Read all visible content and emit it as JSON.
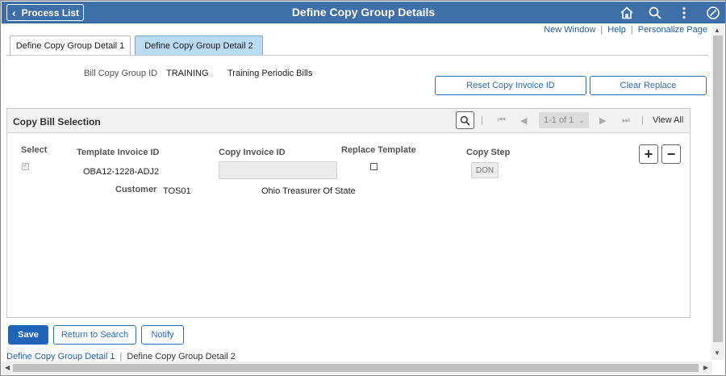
{
  "header": {
    "back_label": "Process List",
    "title": "Define Copy Group Details",
    "icons": [
      "home-icon",
      "search-icon",
      "more-vertical-icon",
      "nav-circle-icon"
    ]
  },
  "top_links": {
    "new_window": "New Window",
    "help": "Help",
    "personalize": "Personalize Page"
  },
  "tabs": [
    {
      "label": "Define Copy Group Detail 1",
      "active": false
    },
    {
      "label": "Define Copy Group Detail 2",
      "active": true
    }
  ],
  "bill_copy_group": {
    "label": "Bill Copy Group ID",
    "id": "TRAINING",
    "description": "Training Periodic Bills"
  },
  "actions": {
    "reset": "Reset Copy Invoice ID",
    "clear": "Clear Replace"
  },
  "grid": {
    "title": "Copy Bill Selection",
    "pager_text": "1-1 of 1",
    "view_all": "View All",
    "columns": {
      "select": "Select",
      "template_invoice_id": "Template Invoice ID",
      "copy_invoice_id": "Copy Invoice ID",
      "replace_template": "Replace Template",
      "copy_step": "Copy Step"
    },
    "row": {
      "select_checked": true,
      "template_invoice_id": "OBA12-1228-ADJ2",
      "copy_invoice_id": "",
      "replace_template": false,
      "copy_step": "DON",
      "customer_label": "Customer",
      "customer_id": "TOS01",
      "customer_name": "Ohio Treasurer Of State"
    },
    "add_symbol": "+",
    "remove_symbol": "−"
  },
  "buttons": {
    "save": "Save",
    "return_to_search": "Return to Search",
    "notify": "Notify"
  },
  "footer_links": {
    "detail1": "Define Copy Group Detail 1",
    "detail2": "Define Copy Group Detail 2"
  },
  "colors": {
    "header_bg": "#3f6fa8",
    "active_tab_bg": "#b9dcf4",
    "primary_button": "#1f64b8",
    "link": "#1f5fa6"
  }
}
